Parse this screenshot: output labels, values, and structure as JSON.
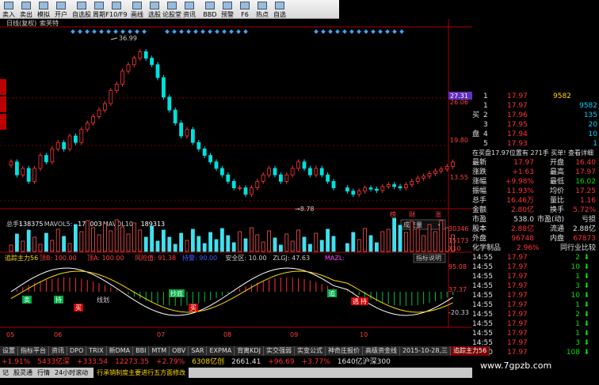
{
  "toolbar": {
    "buttons": [
      {
        "label": "卖入",
        "icon": "buy-icon"
      },
      {
        "label": "卖出",
        "icon": "sell-icon"
      },
      {
        "label": "模拟",
        "icon": "simulate-icon"
      },
      {
        "label": "开户",
        "icon": "account-icon"
      },
      {
        "label": "自选股",
        "icon": "watchlist-icon"
      },
      {
        "label": "周期",
        "icon": "period-icon"
      },
      {
        "label": "F10/F9",
        "icon": "f10-icon"
      },
      {
        "label": "画线",
        "icon": "draw-icon"
      },
      {
        "label": "选股",
        "icon": "select-icon"
      },
      {
        "label": "论股堂",
        "icon": "forum-icon"
      },
      {
        "label": "资讯",
        "icon": "news-icon"
      },
      {
        "label": "BBD",
        "icon": "bbd-icon"
      },
      {
        "label": "预警",
        "icon": "alert-icon"
      },
      {
        "label": "F6",
        "icon": "f6-icon"
      },
      {
        "label": "热点",
        "icon": "hot-icon"
      },
      {
        "label": "自选",
        "icon": "custom-icon"
      }
    ]
  },
  "chart_header": {
    "mode": "日线(复权)",
    "name": "索芙特"
  },
  "price_labels": {
    "high": "36.99",
    "low": "8.78",
    "axis": [
      "27.31",
      "26.06",
      "19.80",
      "13.55"
    ]
  },
  "volume": {
    "prefix": "总手:",
    "total": "138375",
    "mavol5_label": "MAVOL5:",
    "mavol5": "171003",
    "mavol10_label": "MAVOL10:",
    "mavol10": "189313",
    "axis": [
      "30346",
      "15173",
      "X10"
    ],
    "dropdown": "成交量"
  },
  "markers": [
    "榜",
    "财",
    "涨"
  ],
  "indicator": {
    "title": "追踪主力56",
    "items": [
      "顶B: 100.00",
      "顶A: 100.00",
      "风险值: 91.38",
      "持警: 90.00",
      "安全区: 10.00",
      "ZLGJ: 47.63",
      "MAZL:"
    ],
    "help": "指标说明",
    "axis": [
      "95.08",
      "37.37",
      "-20.33"
    ],
    "labels": [
      "卖",
      "买",
      "持",
      "买",
      "抄底",
      "逃",
      "追",
      "持"
    ],
    "text_inside": "线划"
  },
  "x_axis": [
    "05",
    "06",
    "07",
    "08",
    "09",
    "10"
  ],
  "tabs": [
    "设置",
    "指标平台",
    "资讯",
    "DPO",
    "TRIX",
    "新DMA",
    "BBI",
    "MTM",
    "OBV",
    "SAR",
    "EXPMA",
    "背离KDJ",
    "实交强弱",
    "实变公式",
    "神奇庄报价",
    "高级资金线",
    "2015-10-28,三",
    "追踪主力56"
  ],
  "quote": {
    "bid_label": "买",
    "ask_label": "盘",
    "sell_rows": [
      {
        "n": "1",
        "p": "17.97",
        "v": "9582"
      }
    ],
    "buy_rows": [
      {
        "n": "1",
        "p": "17.97",
        "v": "9582"
      },
      {
        "n": "2",
        "p": "17.96",
        "v": "135"
      },
      {
        "n": "3",
        "p": "17.95",
        "v": "20"
      },
      {
        "n": "4",
        "p": "17.94",
        "v": "10"
      },
      {
        "n": "5",
        "p": "17.93",
        "v": "1"
      }
    ],
    "notice": "在买盘17.97位置有 271手  买单! 查看详细",
    "stats": [
      {
        "l1": "最新",
        "v1": "17.97",
        "l2": "开盘",
        "v2": "16.40"
      },
      {
        "l1": "涨跌",
        "v1": "+1.63",
        "l2": "最高",
        "v2": "17.97"
      },
      {
        "l1": "涨幅",
        "v1": "+9.98%",
        "l2": "最低",
        "v2": "16.02"
      },
      {
        "l1": "振幅",
        "v1": "11.93%",
        "l2": "均价",
        "v2": "17.25"
      },
      {
        "l1": "总手",
        "v1": "16.46万",
        "l2": "量比",
        "v2": "1.16"
      },
      {
        "l1": "金额",
        "v1": "2.80亿",
        "l2": "换手",
        "v2": "5.72%"
      },
      {
        "l1": "市盈",
        "v1": "538.0",
        "l2": "市盈(动)",
        "v2": "亏损"
      },
      {
        "l1": "股本",
        "v1": "2.88亿",
        "l2": "流通",
        "v2": "2.88亿"
      },
      {
        "l1": "外盘",
        "v1": "96748",
        "l2": "内盘",
        "v2": "67873"
      }
    ],
    "sector": {
      "name": "化学制品",
      "pct": "2.96%",
      "link": "同行业比较"
    },
    "ticks": [
      {
        "t": "14:55",
        "p": "17.97",
        "v": "2"
      },
      {
        "t": "14:55",
        "p": "17.97",
        "v": "10"
      },
      {
        "t": "14:55",
        "p": "17.97",
        "v": "1"
      },
      {
        "t": "14:55",
        "p": "17.97",
        "v": "3"
      },
      {
        "t": "14:55",
        "p": "17.97",
        "v": "10"
      },
      {
        "t": "14:55",
        "p": "17.97",
        "v": "1"
      },
      {
        "t": "14:55",
        "p": "17.97",
        "v": "2"
      },
      {
        "t": "14:55",
        "p": "17.97",
        "v": "1"
      },
      {
        "t": "14:55",
        "p": "17.97",
        "v": "1"
      },
      {
        "t": "14:55",
        "p": "17.97",
        "v": "3"
      },
      {
        "t": "15:00",
        "p": "17.97",
        "v": "108"
      }
    ]
  },
  "ticker": [
    "+1.91%",
    "5433亿深",
    "+333.54",
    "12273.35",
    "+2.79%",
    "6308亿创",
    "2661.41",
    "+96.69",
    "+3.77%",
    "1640亿沪深300"
  ],
  "status": {
    "items": [
      "记",
      "股灵通",
      "行情",
      "24小时滚动"
    ],
    "news": "行承销制度主要进行五方面修改"
  },
  "watermark": "www.7gpzb.com",
  "colors": {
    "up": "#ff3232",
    "down": "#00e0e0",
    "volume_up": "#ff5050",
    "volume_down": "#40e0f0",
    "accent": "#ffd700"
  }
}
